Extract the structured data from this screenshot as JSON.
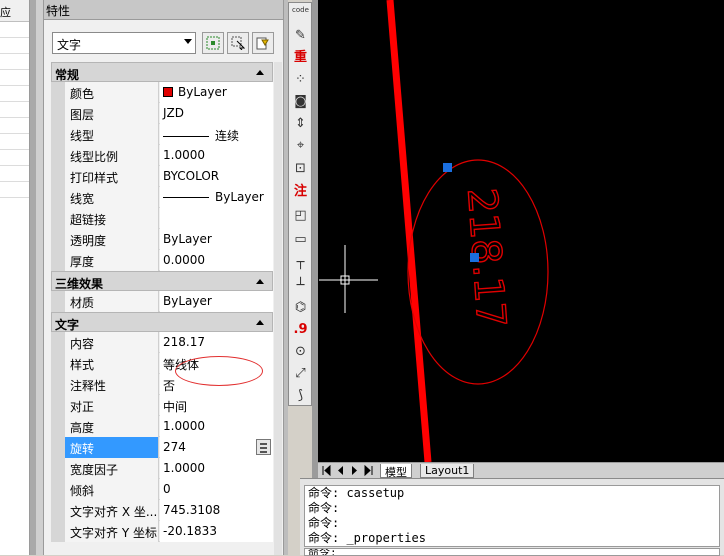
{
  "palette": {
    "title": "特性",
    "object_type": "文字",
    "left_strip_text": "应",
    "categories": {
      "general": {
        "label": "常规",
        "rows": [
          {
            "name": "颜色",
            "value": "ByLayer",
            "swatch": "#e00000"
          },
          {
            "name": "图层",
            "value": "JZD"
          },
          {
            "name": "线型",
            "value": "连续",
            "line_sample": true
          },
          {
            "name": "线型比例",
            "value": "1.0000"
          },
          {
            "name": "打印样式",
            "value": "BYCOLOR"
          },
          {
            "name": "线宽",
            "value": "ByLayer",
            "line_sample": true
          },
          {
            "name": "超链接",
            "value": ""
          },
          {
            "name": "透明度",
            "value": "ByLayer"
          },
          {
            "name": "厚度",
            "value": "0.0000"
          }
        ]
      },
      "three_d": {
        "label": "三维效果",
        "rows": [
          {
            "name": "材质",
            "value": "ByLayer"
          }
        ]
      },
      "text": {
        "label": "文字",
        "rows": [
          {
            "name": "内容",
            "value": "218.17"
          },
          {
            "name": "样式",
            "value": "等线体"
          },
          {
            "name": "注释性",
            "value": "否"
          },
          {
            "name": "对正",
            "value": "中间"
          },
          {
            "name": "高度",
            "value": "1.0000"
          },
          {
            "name": "旋转",
            "value": "274",
            "selected": true
          },
          {
            "name": "宽度因子",
            "value": "1.0000"
          },
          {
            "name": "倾斜",
            "value": "0"
          },
          {
            "name": "文字对齐 X 坐...",
            "value": "745.3108"
          },
          {
            "name": "文字对齐 Y 坐标",
            "value": "-20.1833"
          }
        ]
      }
    }
  },
  "toolbar": {
    "items": [
      {
        "icon": "code-search-icon",
        "glyph": "code"
      },
      {
        "icon": "check-pen-icon",
        "glyph": "✎"
      },
      {
        "icon": "zhong-icon",
        "glyph": "重"
      },
      {
        "icon": "node-grid-icon",
        "glyph": "⁘"
      },
      {
        "icon": "camera-icon",
        "glyph": "◙"
      },
      {
        "icon": "vertical-dim-icon",
        "glyph": "⇕"
      },
      {
        "icon": "xy-coord-icon",
        "glyph": "⌖"
      },
      {
        "icon": "dim-box-icon",
        "glyph": "⊡"
      },
      {
        "icon": "zhu-icon",
        "glyph": "注"
      },
      {
        "icon": "corner-icon",
        "glyph": "◰"
      },
      {
        "icon": "rectangle-icon",
        "glyph": "▭"
      },
      {
        "icon": "measure-icon",
        "glyph": "┬"
      },
      {
        "icon": "baseline-icon",
        "glyph": "┴"
      },
      {
        "icon": "elevation-icon",
        "glyph": "⌬"
      },
      {
        "icon": "decimal-icon",
        "glyph": ".9"
      },
      {
        "icon": "circle-point-icon",
        "glyph": "⊙"
      },
      {
        "icon": "diagonal-icon",
        "glyph": "⤢"
      },
      {
        "icon": "curve-icon",
        "glyph": "⟆"
      }
    ]
  },
  "drawing": {
    "label_text": "218.17",
    "text_color": "#e00000",
    "line_color": "#ff0000",
    "grip_color": "#1a6fe0"
  },
  "tabs": {
    "model": "模型",
    "layout1": "Layout1"
  },
  "command": {
    "history": [
      "命令: cassetup",
      "命令:",
      "命令:",
      "命令: _properties"
    ],
    "prompt": "命令:"
  }
}
